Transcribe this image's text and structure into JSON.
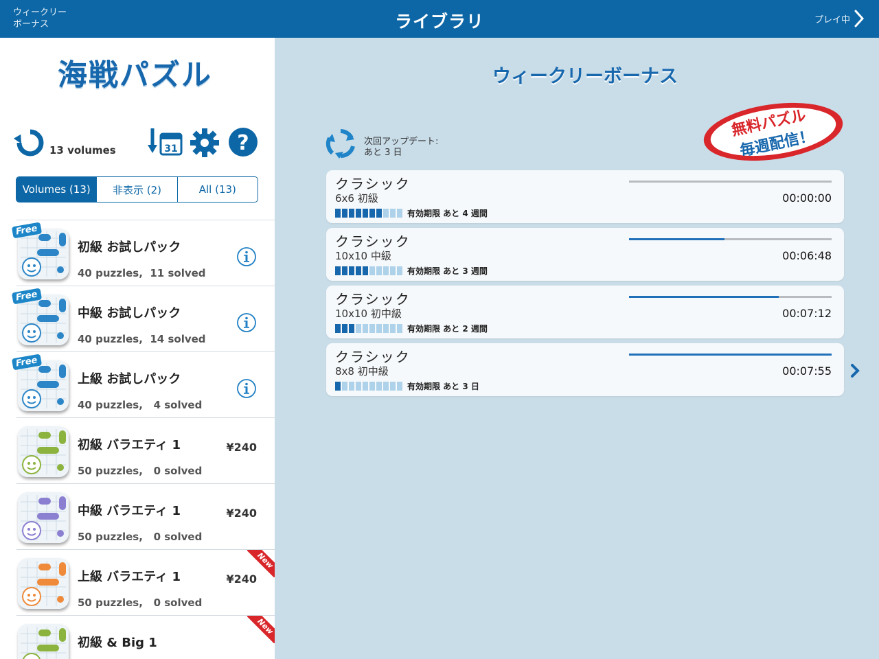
{
  "nav": {
    "left_label": "ウィークリー\nボーナス",
    "title": "ライブラリ",
    "right_label": "プレイ中"
  },
  "sidebar": {
    "logo": "海戦パズル",
    "volume_count": "13 volumes",
    "segments": [
      {
        "label": "Volumes (13)",
        "active": true
      },
      {
        "label": "非表示 (2)",
        "active": false
      },
      {
        "label": "All (13)",
        "active": false
      }
    ],
    "packs": [
      {
        "title": "初級 お試しパック",
        "sub": "40 puzzles,  11 solved",
        "badge": "Free",
        "price": "",
        "info": true,
        "color": "#2b85c6"
      },
      {
        "title": "中級 お試しパック",
        "sub": "40 puzzles,  14 solved",
        "badge": "Free",
        "price": "",
        "info": true,
        "color": "#2b85c6"
      },
      {
        "title": "上級 お試しパック",
        "sub": "40 puzzles,   4 solved",
        "badge": "Free",
        "price": "",
        "info": true,
        "color": "#2b85c6"
      },
      {
        "title": "初級 バラエティ 1",
        "sub": "50 puzzles,   0 solved",
        "badge": "",
        "price": "¥240",
        "info": false,
        "color": "#8cb33e"
      },
      {
        "title": "中級 バラエティ 1",
        "sub": "50 puzzles,   0 solved",
        "badge": "",
        "price": "¥240",
        "info": false,
        "color": "#8a7fd0"
      },
      {
        "title": "上級 バラエティ 1",
        "sub": "50 puzzles,   0 solved",
        "badge": "New",
        "price": "¥240",
        "info": false,
        "color": "#ee8a3a"
      },
      {
        "title": "初級 & Big 1",
        "sub": "",
        "badge": "New",
        "price": "",
        "info": false,
        "color": "#8cb33e"
      }
    ]
  },
  "bonus": {
    "title": "ウィークリーボーナス",
    "update_label": "次回アップデート:",
    "update_value": "あと 3 日",
    "stamp_line1": "無料パズル",
    "stamp_line2": "毎週配信！",
    "cards": [
      {
        "title": "クラシック",
        "sub": "6x6 初級",
        "time": "00:00:00",
        "progress": 0.0,
        "segments_on": 7,
        "expiry": "有効期限 あと 4 週間"
      },
      {
        "title": "クラシック",
        "sub": "10x10 中級",
        "time": "00:06:48",
        "progress": 0.47,
        "segments_on": 5,
        "expiry": "有効期限 あと 3 週間"
      },
      {
        "title": "クラシック",
        "sub": "10x10 初中級",
        "time": "00:07:12",
        "progress": 0.74,
        "segments_on": 3,
        "expiry": "有効期限 あと 2 週間"
      },
      {
        "title": "クラシック",
        "sub": "8x8 初中級",
        "time": "00:07:55",
        "progress": 1.0,
        "segments_on": 1,
        "expiry": "有効期限 あと 3 日"
      }
    ],
    "accent_color": "#1767ad"
  }
}
